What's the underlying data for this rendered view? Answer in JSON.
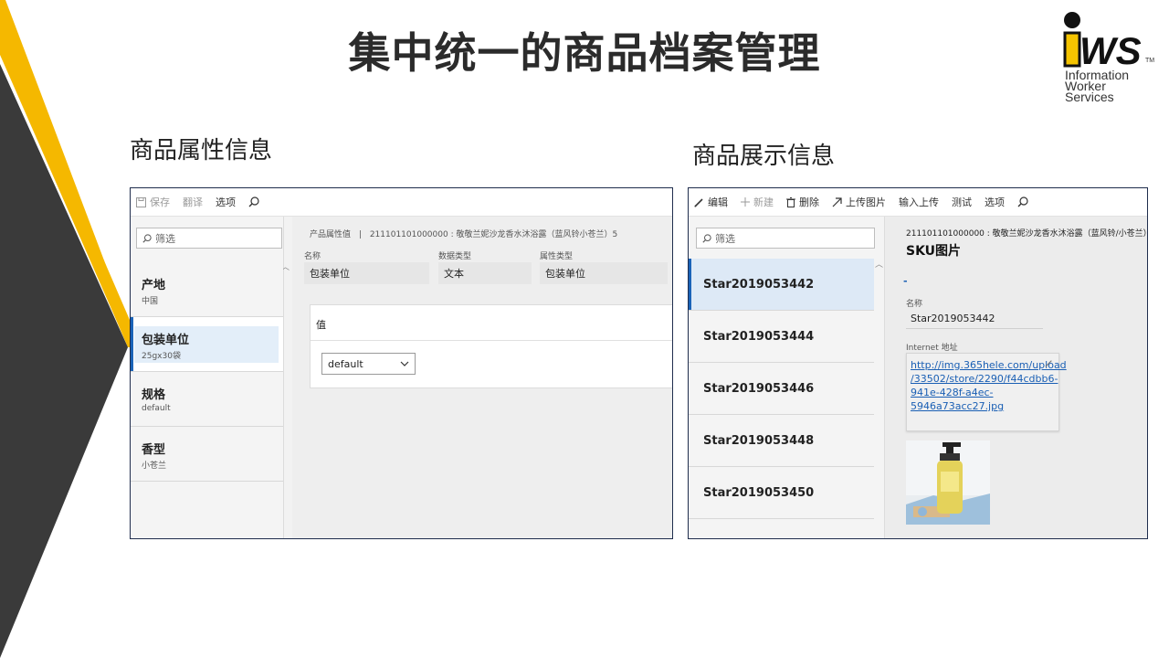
{
  "slide": {
    "title": "集中统一的商品档案管理"
  },
  "logo": {
    "mark": "iWS",
    "lines": [
      "Information",
      "Worker",
      "Services"
    ],
    "tm": "TM"
  },
  "sections": {
    "left_label": "商品属性信息",
    "right_label": "商品展示信息"
  },
  "left_panel": {
    "toolbar": {
      "save": "保存",
      "translate": "翻译",
      "options": "选项"
    },
    "filter_placeholder": "筛选",
    "items": [
      {
        "title": "产地",
        "sub": "中国"
      },
      {
        "title": "包装单位",
        "sub": "25gx30袋"
      },
      {
        "title": "规格",
        "sub": "default"
      },
      {
        "title": "香型",
        "sub": "小苍兰"
      }
    ],
    "detail": {
      "breadcrumb_label": "产品属性值",
      "breadcrumb_sep": "|",
      "breadcrumb_value": "211101101000000 : 敬敬兰妮沙龙香水沐浴露（蓝风铃小苍兰）5",
      "fields": [
        {
          "label": "名称",
          "value": "包装单位"
        },
        {
          "label": "数据类型",
          "value": "文本"
        },
        {
          "label": "属性类型",
          "value": "包装单位"
        }
      ],
      "value_title": "值",
      "value_select": "default"
    }
  },
  "right_panel": {
    "toolbar": {
      "edit": "编辑",
      "new": "新建",
      "delete": "删除",
      "upload_image": "上传图片",
      "import_upload": "输入上传",
      "test": "测试",
      "options": "选项"
    },
    "filter_placeholder": "筛选",
    "items": [
      "Star2019053442",
      "Star2019053444",
      "Star2019053446",
      "Star2019053448",
      "Star2019053450"
    ],
    "detail": {
      "header": "211101101000000 : 敬敬兰妮沙龙香水沐浴露（蓝风铃/小苍兰）",
      "title": "SKU图片",
      "dash": "-",
      "name_label": "名称",
      "name_value": "Star2019053442",
      "url_label": "Internet 地址",
      "url_lines": [
        "http://img.365hele.com/upload",
        "/33502/store/2290/f44cdbb6-",
        "941e-428f-a4ec-",
        "5946a73acc27.jpg"
      ]
    }
  },
  "colors": {
    "yellow_stripe": "#f5b800",
    "dark_stripe": "#3a3a3a",
    "panel_border": "#1f2d4d",
    "accent_blue": "#1a63b8",
    "selected_bg": "#dde9f6"
  }
}
